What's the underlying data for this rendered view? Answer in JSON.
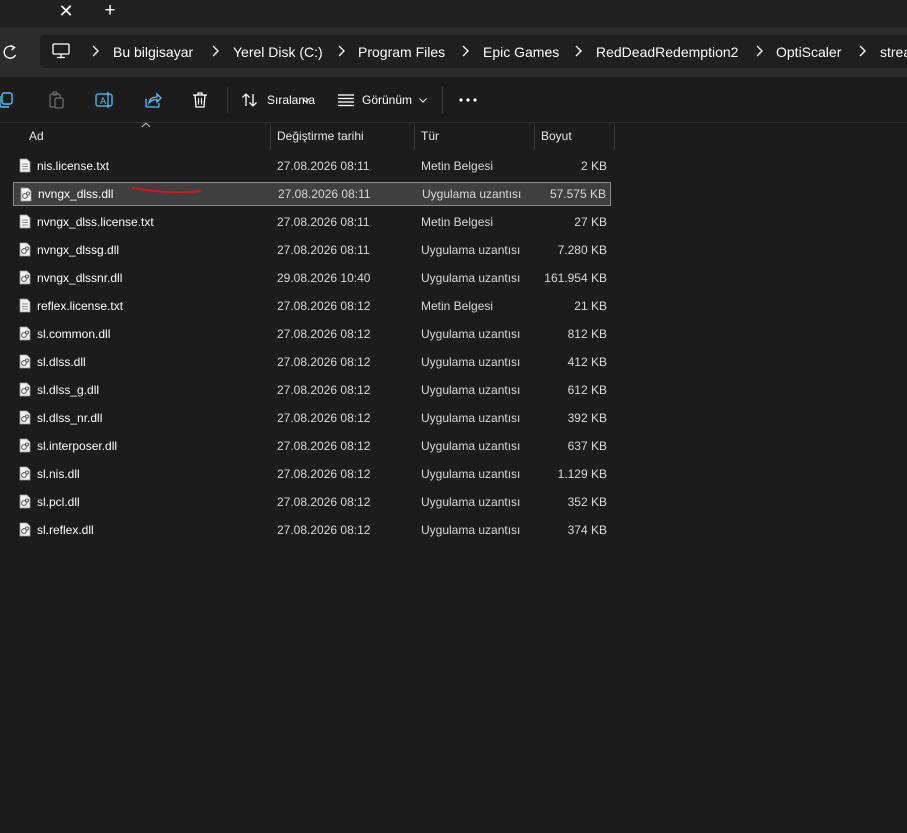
{
  "tabstrip": {
    "close_glyph": "✕",
    "add_glyph": "+"
  },
  "breadcrumb": [
    "Bu bilgisayar",
    "Yerel Disk (C:)",
    "Program Files",
    "Epic Games",
    "RedDeadRedemption2",
    "OptiScaler",
    "strea"
  ],
  "toolbar": {
    "sort_label": "Sıralama",
    "view_label": "Görünüm"
  },
  "columns": {
    "name": "Ad",
    "date": "Değiştirme tarihi",
    "type": "Tür",
    "size": "Boyut"
  },
  "files": [
    {
      "name": "nis.license.txt",
      "date": "27.08.2026 08:11",
      "type": "Metin Belgesi",
      "size": "2 KB",
      "kind": "txt"
    },
    {
      "name": "nvngx_dlss.dll",
      "date": "27.08.2026 08:11",
      "type": "Uygulama uzantısı",
      "size": "57.575 KB",
      "kind": "dll",
      "selected": true
    },
    {
      "name": "nvngx_dlss.license.txt",
      "date": "27.08.2026 08:11",
      "type": "Metin Belgesi",
      "size": "27 KB",
      "kind": "txt"
    },
    {
      "name": "nvngx_dlssg.dll",
      "date": "27.08.2026 08:11",
      "type": "Uygulama uzantısı",
      "size": "7.280 KB",
      "kind": "dll"
    },
    {
      "name": "nvngx_dlssnr.dll",
      "date": "29.08.2026 10:40",
      "type": "Uygulama uzantısı",
      "size": "161.954 KB",
      "kind": "dll"
    },
    {
      "name": "reflex.license.txt",
      "date": "27.08.2026 08:12",
      "type": "Metin Belgesi",
      "size": "21 KB",
      "kind": "txt"
    },
    {
      "name": "sl.common.dll",
      "date": "27.08.2026 08:12",
      "type": "Uygulama uzantısı",
      "size": "812 KB",
      "kind": "dll"
    },
    {
      "name": "sl.dlss.dll",
      "date": "27.08.2026 08:12",
      "type": "Uygulama uzantısı",
      "size": "412 KB",
      "kind": "dll"
    },
    {
      "name": "sl.dlss_g.dll",
      "date": "27.08.2026 08:12",
      "type": "Uygulama uzantısı",
      "size": "612 KB",
      "kind": "dll"
    },
    {
      "name": "sl.dlss_nr.dll",
      "date": "27.08.2026 08:12",
      "type": "Uygulama uzantısı",
      "size": "392 KB",
      "kind": "dll"
    },
    {
      "name": "sl.interposer.dll",
      "date": "27.08.2026 08:12",
      "type": "Uygulama uzantısı",
      "size": "637 KB",
      "kind": "dll"
    },
    {
      "name": "sl.nis.dll",
      "date": "27.08.2026 08:12",
      "type": "Uygulama uzantısı",
      "size": "1.129 KB",
      "kind": "dll"
    },
    {
      "name": "sl.pcl.dll",
      "date": "27.08.2026 08:12",
      "type": "Uygulama uzantısı",
      "size": "352 KB",
      "kind": "dll"
    },
    {
      "name": "sl.reflex.dll",
      "date": "27.08.2026 08:12",
      "type": "Uygulama uzantısı",
      "size": "374 KB",
      "kind": "dll"
    }
  ],
  "colors": {
    "accent": "#4cc2ff",
    "selection": "#3f3f3f",
    "annotation": "#d0161e"
  }
}
